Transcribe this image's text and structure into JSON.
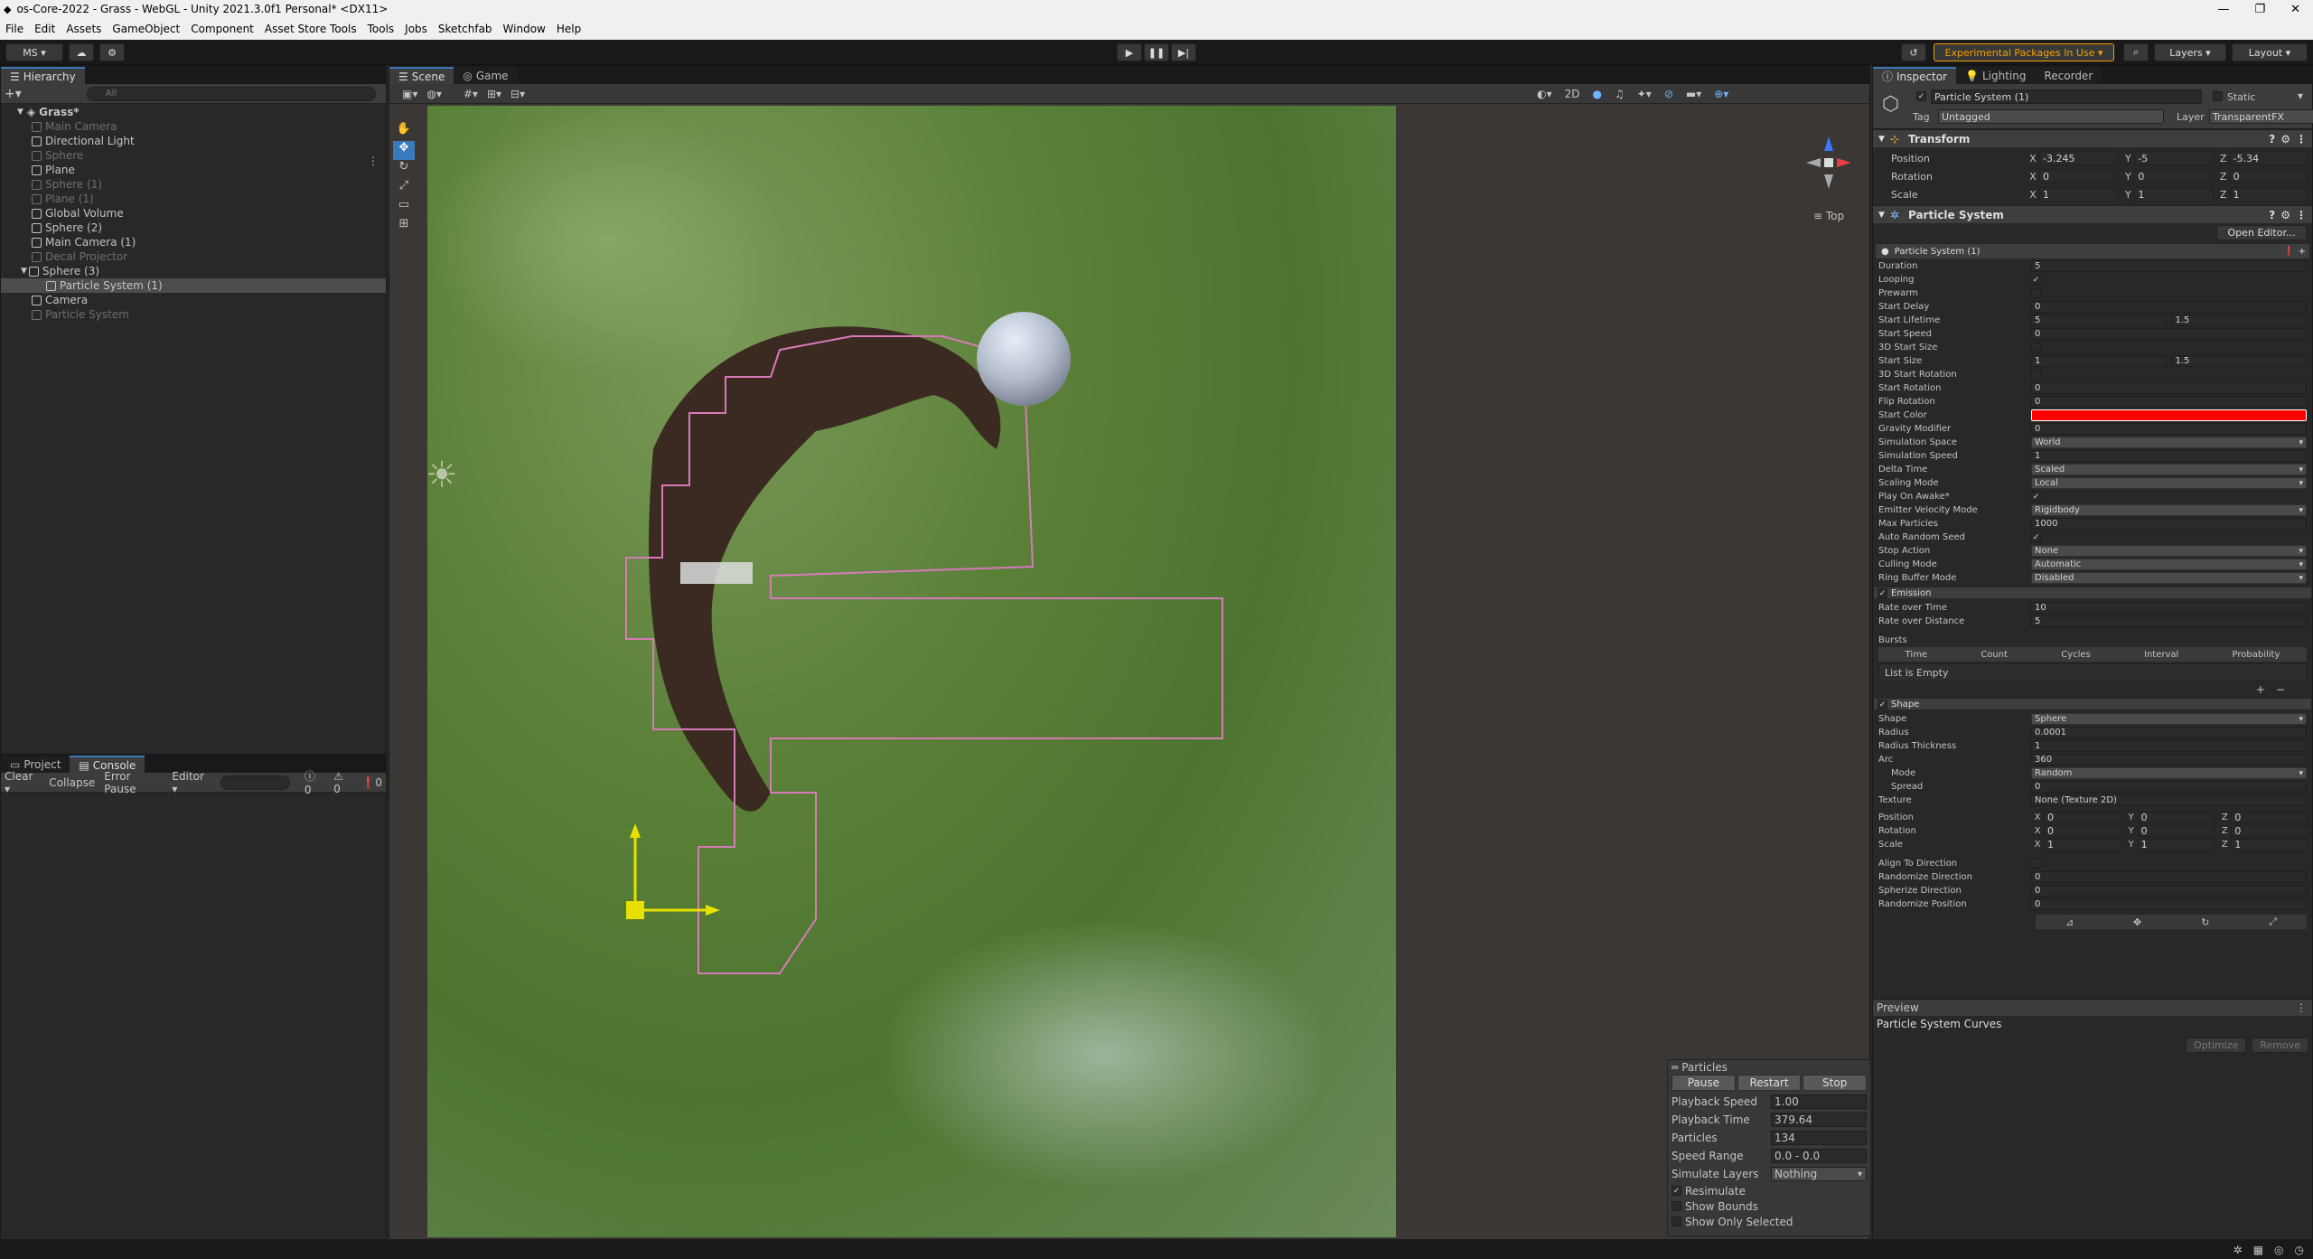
{
  "window": {
    "title": "os-Core-2022 - Grass - WebGL - Unity 2021.3.0f1 Personal* <DX11>"
  },
  "menu": [
    "File",
    "Edit",
    "Assets",
    "GameObject",
    "Component",
    "Asset Store Tools",
    "Tools",
    "Jobs",
    "Sketchfab",
    "Window",
    "Help"
  ],
  "toolbar": {
    "account": "MS",
    "experimental": "Experimental Packages In Use",
    "layers": "Layers",
    "layout": "Layout"
  },
  "hierarchy": {
    "tab": "Hierarchy",
    "search_placeholder": "All",
    "scene": "Grass*",
    "items": [
      {
        "label": "Main Camera",
        "dim": true,
        "indent": 1
      },
      {
        "label": "Directional Light",
        "dim": false,
        "indent": 1
      },
      {
        "label": "Sphere",
        "dim": true,
        "indent": 1
      },
      {
        "label": "Plane",
        "dim": false,
        "indent": 1
      },
      {
        "label": "Sphere (1)",
        "dim": true,
        "indent": 1
      },
      {
        "label": "Plane (1)",
        "dim": true,
        "indent": 1
      },
      {
        "label": "Global Volume",
        "dim": false,
        "indent": 1
      },
      {
        "label": "Sphere (2)",
        "dim": false,
        "indent": 1
      },
      {
        "label": "Main Camera (1)",
        "dim": false,
        "indent": 1
      },
      {
        "label": "Decal Projector",
        "dim": true,
        "indent": 1
      },
      {
        "label": "Sphere (3)",
        "dim": false,
        "indent": 1,
        "expanded": true
      },
      {
        "label": "Particle System (1)",
        "dim": false,
        "indent": 2,
        "selected": true
      },
      {
        "label": "Camera",
        "dim": false,
        "indent": 1
      },
      {
        "label": "Particle System",
        "dim": true,
        "indent": 1
      }
    ]
  },
  "bottom_panel": {
    "tabs": [
      "Project",
      "Console"
    ],
    "clear": "Clear",
    "collapse": "Collapse",
    "error_pause": "Error Pause",
    "editor": "Editor",
    "counts": [
      "0",
      "0",
      "0"
    ]
  },
  "scene_view": {
    "tabs": [
      "Scene",
      "Game"
    ],
    "mode_2d": "2D",
    "gizmo_label": "Top"
  },
  "particles_overlay": {
    "title": "Particles",
    "buttons": [
      "Pause",
      "Restart",
      "Stop"
    ],
    "rows": [
      {
        "label": "Playback Speed",
        "value": "1.00"
      },
      {
        "label": "Playback Time",
        "value": "379.64"
      },
      {
        "label": "Particles",
        "value": "134"
      },
      {
        "label": "Speed Range",
        "value": "0.0 - 0.0"
      },
      {
        "label": "Simulate Layers",
        "value": "Nothing"
      }
    ],
    "checks": [
      {
        "label": "Resimulate",
        "checked": true
      },
      {
        "label": "Show Bounds",
        "checked": false
      },
      {
        "label": "Show Only Selected",
        "checked": false
      }
    ]
  },
  "inspector": {
    "tabs": [
      "Inspector",
      "Lighting",
      "Recorder"
    ],
    "object_name": "Particle System (1)",
    "static_label": "Static",
    "tag_label": "Tag",
    "tag": "Untagged",
    "layer_label": "Layer",
    "layer": "TransparentFX",
    "transform": {
      "title": "Transform",
      "position_label": "Position",
      "rotation_label": "Rotation",
      "scale_label": "Scale",
      "position": [
        "-3.245",
        "-5",
        "-5.34"
      ],
      "rotation": [
        "0",
        "0",
        "0"
      ],
      "scale": [
        "1",
        "1",
        "1"
      ]
    },
    "particle_system": {
      "title": "Particle System",
      "open_editor": "Open Editor...",
      "module_title": "Particle System (1)",
      "rows": [
        {
          "label": "Duration",
          "value": "5",
          "kind": "text"
        },
        {
          "label": "Looping",
          "value": "✓",
          "kind": "check"
        },
        {
          "label": "Prewarm",
          "value": "",
          "kind": "check"
        },
        {
          "label": "Start Delay",
          "value": "0",
          "kind": "text"
        },
        {
          "label": "Start Lifetime",
          "value": "5",
          "value2": "1.5",
          "kind": "dual"
        },
        {
          "label": "Start Speed",
          "value": "0",
          "kind": "text"
        },
        {
          "label": "3D Start Size",
          "value": "",
          "kind": "check"
        },
        {
          "label": "Start Size",
          "value": "1",
          "value2": "1.5",
          "kind": "dual"
        },
        {
          "label": "3D Start Rotation",
          "value": "",
          "kind": "check"
        },
        {
          "label": "Start Rotation",
          "value": "0",
          "kind": "text"
        },
        {
          "label": "Flip Rotation",
          "value": "0",
          "kind": "text"
        },
        {
          "label": "Start Color",
          "value": "",
          "kind": "color"
        },
        {
          "label": "Gravity Modifier",
          "value": "0",
          "kind": "text"
        },
        {
          "label": "Simulation Space",
          "value": "World",
          "kind": "drop"
        },
        {
          "label": "Simulation Speed",
          "value": "1",
          "kind": "text"
        },
        {
          "label": "Delta Time",
          "value": "Scaled",
          "kind": "drop"
        },
        {
          "label": "Scaling Mode",
          "value": "Local",
          "kind": "drop"
        },
        {
          "label": "Play On Awake*",
          "value": "✓",
          "kind": "check"
        },
        {
          "label": "Emitter Velocity Mode",
          "value": "Rigidbody",
          "kind": "drop"
        },
        {
          "label": "Max Particles",
          "value": "1000",
          "kind": "text"
        },
        {
          "label": "Auto Random Seed",
          "value": "✓",
          "kind": "check"
        },
        {
          "label": "Stop Action",
          "value": "None",
          "kind": "drop"
        },
        {
          "label": "Culling Mode",
          "value": "Automatic",
          "kind": "drop"
        },
        {
          "label": "Ring Buffer Mode",
          "value": "Disabled",
          "kind": "drop"
        }
      ],
      "emission": {
        "title": "Emission",
        "rows": [
          {
            "label": "Rate over Time",
            "value": "10"
          },
          {
            "label": "Rate over Distance",
            "value": "5"
          }
        ],
        "bursts_label": "Bursts",
        "burst_columns": [
          "Time",
          "Count",
          "Cycles",
          "Interval",
          "Probability"
        ],
        "empty": "List is Empty"
      },
      "shape": {
        "title": "Shape",
        "rows": [
          {
            "label": "Shape",
            "value": "Sphere",
            "kind": "drop"
          },
          {
            "label": "Radius",
            "value": "0.0001",
            "kind": "text"
          },
          {
            "label": "Radius Thickness",
            "value": "1",
            "kind": "text"
          },
          {
            "label": "Arc",
            "value": "360",
            "kind": "text"
          },
          {
            "label": "Mode",
            "value": "Random",
            "kind": "drop",
            "sub": true
          },
          {
            "label": "Spread",
            "value": "0",
            "kind": "text",
            "sub": true
          },
          {
            "label": "Texture",
            "value": "None (Texture 2D)",
            "kind": "text"
          }
        ],
        "position_label": "Position",
        "rotation_label": "Rotation",
        "scale_label": "Scale",
        "position": [
          "0",
          "0",
          "0"
        ],
        "rotation": [
          "0",
          "0",
          "0"
        ],
        "scale": [
          "1",
          "1",
          "1"
        ],
        "rows2": [
          {
            "label": "Align To Direction",
            "value": "",
            "kind": "check"
          },
          {
            "label": "Randomize Direction",
            "value": "0",
            "kind": "text"
          },
          {
            "label": "Spherize Direction",
            "value": "0",
            "kind": "text"
          },
          {
            "label": "Randomize Position",
            "value": "0",
            "kind": "text"
          }
        ]
      }
    },
    "preview": {
      "tab": "Preview",
      "title": "Particle System Curves",
      "optimize": "Optimize",
      "remove": "Remove"
    }
  },
  "colors": {
    "accent": "#3a79bb",
    "start_color": "#ff0000",
    "experimental": "#f0a000",
    "grass": "#5a8a3a",
    "bounds": "#d87ab8"
  }
}
